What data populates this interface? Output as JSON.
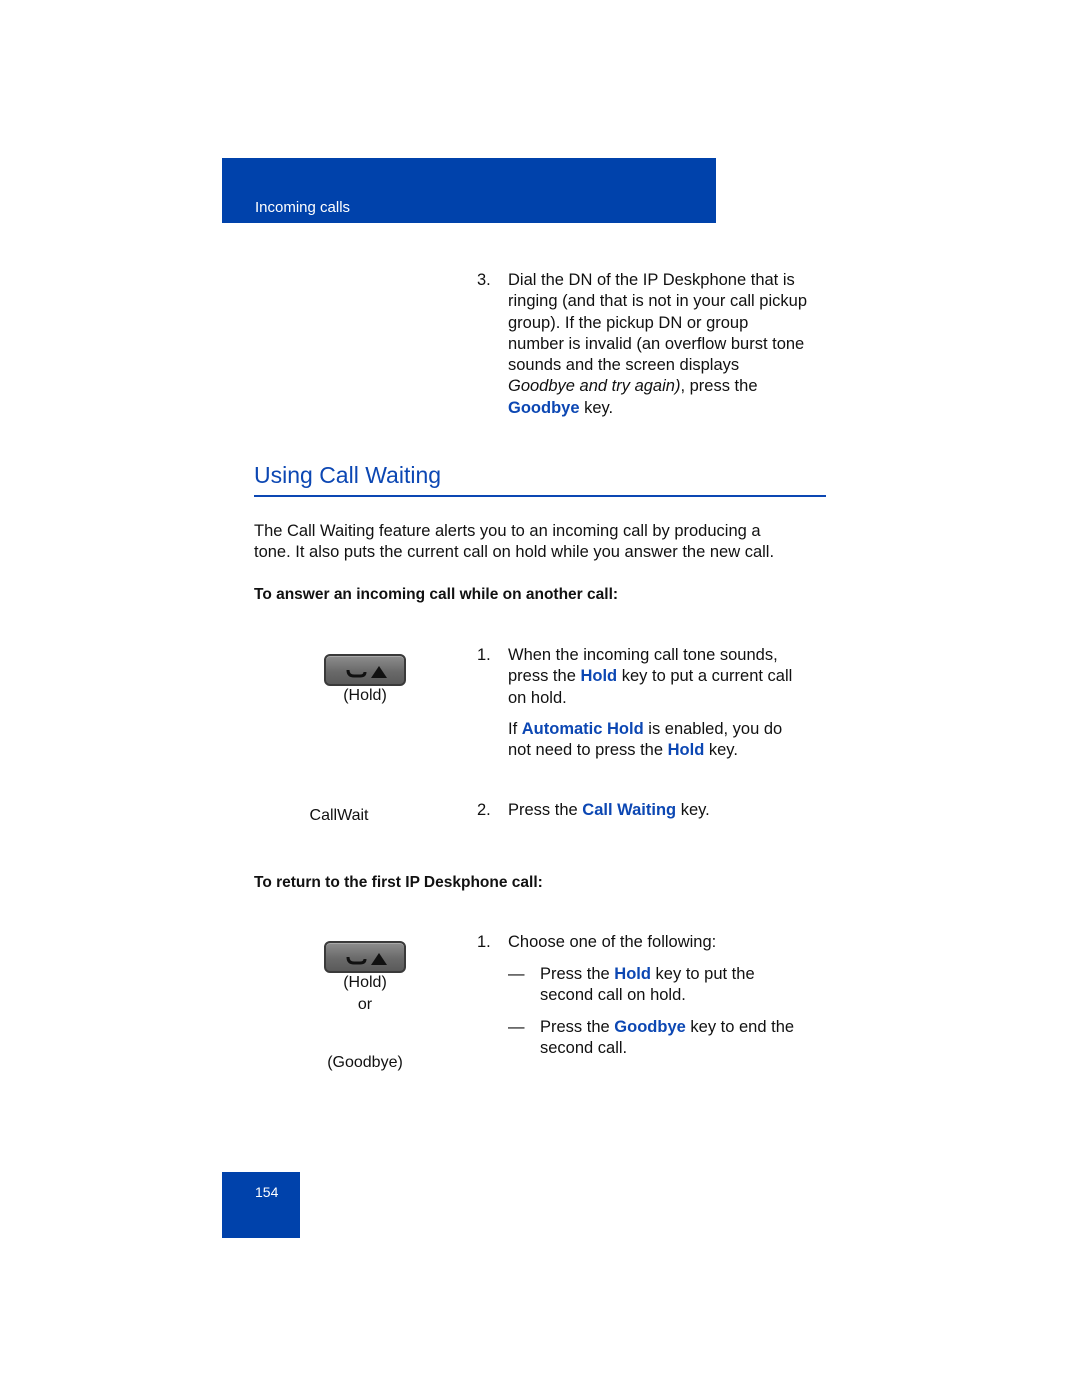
{
  "header": {
    "section": "Incoming calls"
  },
  "step3": {
    "number": "3.",
    "line1": "Dial the DN of the IP Deskphone that is",
    "line2": "ringing (and that is not in your call pickup",
    "line3": "group). If the pickup DN or group",
    "line4": "number is invalid (an overflow burst tone",
    "line5": "sounds and the screen displays",
    "italic": "Goodbye and try again)",
    "after_italic": ", press the",
    "key": "Goodbye",
    "end": " key."
  },
  "section": {
    "title": "Using Call Waiting",
    "intro_line1": "The Call Waiting feature alerts you to an incoming call by producing a",
    "intro_line2": "tone. It also puts the current call on hold while you answer the new call."
  },
  "procedure1": {
    "heading": "To answer an incoming call while on another call:",
    "hold_label": "(Hold)",
    "callwait_label": "CallWait",
    "step1": {
      "number": "1.",
      "line1": "When the incoming call tone sounds,",
      "pre": "press the ",
      "key": "Hold",
      "post": " key to put a current call",
      "line3": "on hold."
    },
    "note": {
      "pre": "If ",
      "key1": "Automatic Hold",
      "mid": " is enabled, you do",
      "pre2": "not need to press the ",
      "key2": "Hold",
      "end": " key."
    },
    "step2": {
      "number": "2.",
      "pre": "Press the ",
      "key": "Call Waiting",
      "post": " key."
    }
  },
  "procedure2": {
    "heading": "To return to the first IP Deskphone call:",
    "hold_label": "(Hold)",
    "or_label": "or",
    "goodbye_label": "(Goodbye)",
    "step1": {
      "number": "1.",
      "text": "Choose one of the following:"
    },
    "options": [
      {
        "dash": "—",
        "pre": "Press the ",
        "key": "Hold",
        "post": " key to put the",
        "line2": "second call on hold."
      },
      {
        "dash": "—",
        "pre": "Press the ",
        "key": "Goodbye",
        "post": " key to end the",
        "line2": "second call."
      }
    ]
  },
  "footer": {
    "page_number": "154"
  },
  "colors": {
    "brand_blue": "#0042ab",
    "link_blue": "#0c47b3"
  }
}
